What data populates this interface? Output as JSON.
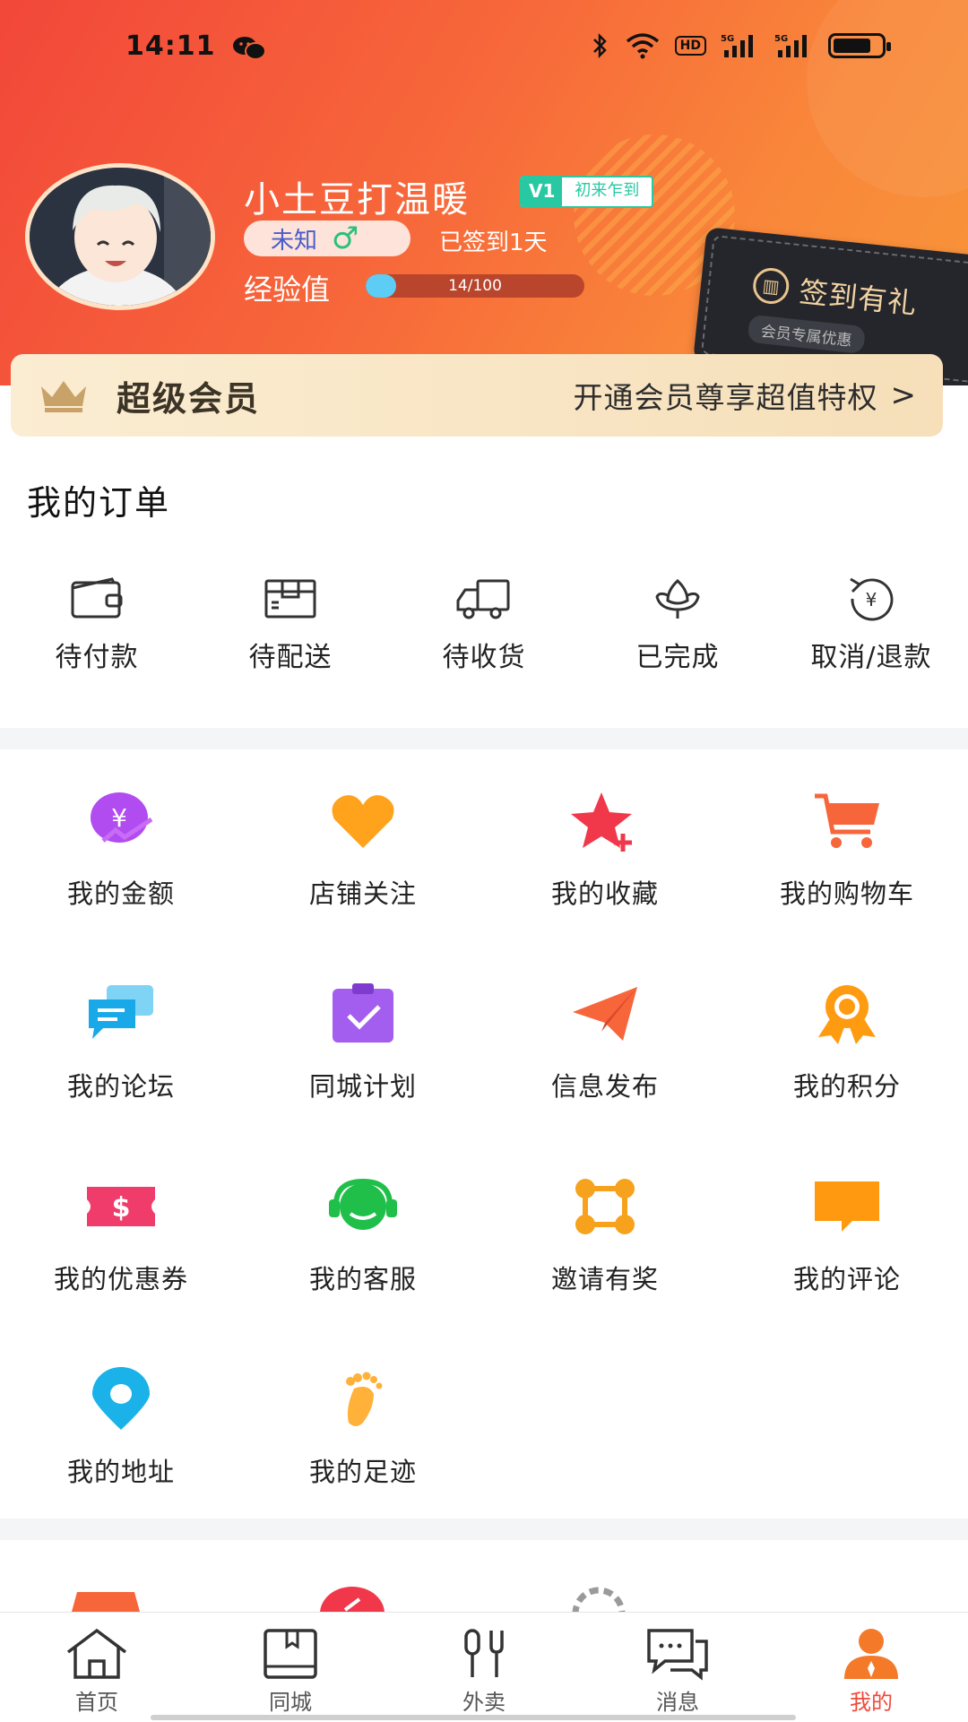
{
  "status_bar": {
    "time": "14:11",
    "hd": "HD"
  },
  "profile": {
    "username": "小土豆打温暖",
    "level": "V1",
    "level_title": "初来乍到",
    "gender": "未知",
    "gender_symbol": "♂",
    "checkin_days": "已签到1天",
    "exp_label": "经验值",
    "exp_text": "14/100",
    "exp_progress": 0.14
  },
  "checkin_card": {
    "title": "签到有礼",
    "subtitle": "会员专属优惠"
  },
  "vip": {
    "title": "超级会员",
    "promo": "开通会员尊享超值特权",
    "arrow": ">"
  },
  "orders": {
    "title": "我的订单",
    "items": [
      {
        "label": "待付款",
        "icon": "wallet-icon"
      },
      {
        "label": "待配送",
        "icon": "box-icon"
      },
      {
        "label": "待收货",
        "icon": "truck-icon"
      },
      {
        "label": "已完成",
        "icon": "lotus-icon"
      },
      {
        "label": "取消/退款",
        "icon": "refund-icon"
      }
    ]
  },
  "services": [
    {
      "label": "我的金额",
      "icon": "money-icon",
      "color": "#b14cf0"
    },
    {
      "label": "店铺关注",
      "icon": "heart-icon",
      "color": "#ffa21c"
    },
    {
      "label": "我的收藏",
      "icon": "star-icon",
      "color": "#f0384a"
    },
    {
      "label": "我的购物车",
      "icon": "cart-icon",
      "color": "#f7663a"
    },
    {
      "label": "我的论坛",
      "icon": "forum-icon",
      "color": "#1aa9e8"
    },
    {
      "label": "同城计划",
      "icon": "plan-icon",
      "color": "#a35ef0"
    },
    {
      "label": "信息发布",
      "icon": "send-icon",
      "color": "#f7663a"
    },
    {
      "label": "我的积分",
      "icon": "medal-icon",
      "color": "#ff9b10"
    },
    {
      "label": "我的优惠券",
      "icon": "coupon-icon",
      "color": "#f03c6a"
    },
    {
      "label": "我的客服",
      "icon": "headset-icon",
      "color": "#1fbf4a"
    },
    {
      "label": "邀请有奖",
      "icon": "invite-icon",
      "color": "#f7a21c"
    },
    {
      "label": "我的评论",
      "icon": "comment-icon",
      "color": "#ff9a10"
    },
    {
      "label": "我的地址",
      "icon": "location-icon",
      "color": "#1ab2e8"
    },
    {
      "label": "我的足迹",
      "icon": "footprint-icon",
      "color": "#ffb13a"
    }
  ],
  "tabbar": [
    {
      "label": "首页",
      "icon": "home-icon",
      "active": false
    },
    {
      "label": "同城",
      "icon": "city-icon",
      "active": false
    },
    {
      "label": "外卖",
      "icon": "takeout-icon",
      "active": false
    },
    {
      "label": "消息",
      "icon": "message-icon",
      "active": false
    },
    {
      "label": "我的",
      "icon": "profile-icon",
      "active": true
    }
  ],
  "colors": {
    "brand": "#f7663a",
    "accent": "#f04a3a",
    "vip_bg": "#fbedd2"
  }
}
